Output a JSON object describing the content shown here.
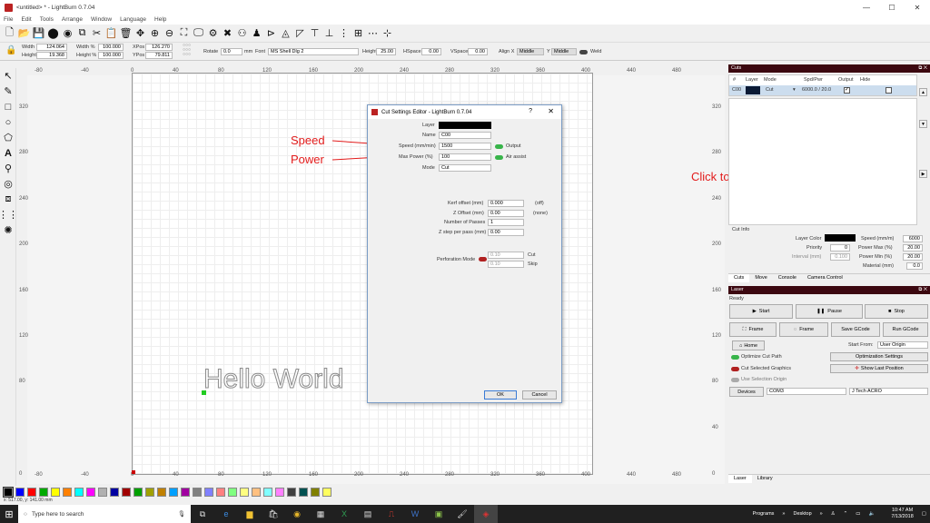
{
  "window": {
    "title": "<untitled> * - LightBurn 0.7.04"
  },
  "menu": [
    "File",
    "Edit",
    "Tools",
    "Arrange",
    "Window",
    "Language",
    "Help"
  ],
  "toolbar": {
    "icons": [
      "new-file-icon",
      "open-folder-icon",
      "save-icon",
      "import-icon",
      "export-icon",
      "copy-icon",
      "cut-icon",
      "paste-icon",
      "delete-icon",
      "move-icon",
      "zoom-in-icon",
      "zoom-out-icon",
      "zoom-frame-icon",
      "monitor-icon",
      "settings-icon",
      "tools-icon",
      "users-icon",
      "person-icon",
      "send-icon",
      "mirror-icon",
      "send-icon-2",
      "align-icon-1",
      "align-icon-2",
      "align-icon-3",
      "align-icon-4",
      "align-icon-5",
      "align-icon-6"
    ]
  },
  "transform": {
    "width_label": "Width",
    "width_value": "124.064",
    "height_label": "Height",
    "height_value": "19.368",
    "widthpct_label": "Width %",
    "widthpct_value": "100.000",
    "heightpct_label": "Height %",
    "heightpct_value": "100.000",
    "xpos_label": "XPos",
    "xpos_value": "126.270",
    "ypos_label": "YPos",
    "ypos_value": "79.811",
    "rotate_label": "Rotate",
    "rotate_value": "0.0",
    "mm_label": "mm"
  },
  "text_tools": {
    "font_label": "Font",
    "font_value": "MS Shell Dlg 2",
    "height_label": "Height",
    "height_value": "25.00",
    "hspace_label": "HSpace",
    "hspace_value": "0.00",
    "vspace_label": "VSpace",
    "vspace_value": "0.00",
    "alignx_label": "Align X",
    "alignx_value": "Middle",
    "aligny_label": "Y",
    "aligny_value": "Middle",
    "weld_label": "Weld"
  },
  "rulers": {
    "top": [
      "-80",
      "-40",
      "0",
      "40",
      "80",
      "120",
      "160",
      "200",
      "240",
      "280",
      "320",
      "360",
      "400",
      "440",
      "480"
    ],
    "left": [
      "320",
      "280",
      "240",
      "200",
      "160",
      "120",
      "80",
      "0"
    ],
    "bottom": [
      "-80",
      "-40",
      "0",
      "40",
      "80",
      "120",
      "160",
      "200",
      "240",
      "280",
      "320",
      "360",
      "400",
      "440",
      "480"
    ],
    "right": [
      "320",
      "280",
      "240",
      "200",
      "160",
      "120",
      "80",
      "40",
      "0"
    ]
  },
  "canvas_text": "Hello World",
  "annotations": {
    "speed": "Speed",
    "power": "Power",
    "click_note": "Click to change speed and power"
  },
  "dialog": {
    "title": "Cut Settings Editor - LightBurn 0.7.04",
    "help": "?",
    "close": "✕",
    "layer_label": "Layer",
    "name_label": "Name",
    "name_value": "C00",
    "speed_label": "Speed (mm/min)",
    "speed_value": "1500",
    "maxpower_label": "Max Power (%)",
    "maxpower_value": "100",
    "mode_label": "Mode",
    "mode_value": "Cut",
    "output_label": "Output",
    "airassist_label": "Air assist",
    "kerf_label": "Kerf offset (mm)",
    "kerf_value": "0.000",
    "kerf_state": "(off)",
    "zoffset_label": "Z Offset (mm)",
    "zoffset_value": "0.00",
    "zoffset_state": "(none)",
    "passes_label": "Number of Passes",
    "passes_value": "1",
    "zstep_label": "Z step per pass (mm)",
    "zstep_value": "0.00",
    "perforation_label": "Perforation Mode",
    "perf_cut_value": "0.10",
    "perf_cut_label": "Cut",
    "perf_skip_value": "0.10",
    "perf_skip_label": "Skip",
    "ok": "OK",
    "cancel": "Cancel"
  },
  "cuts_panel": {
    "title": "Cuts",
    "headers": [
      "#",
      "Layer",
      "Mode",
      "Spd/Pwr",
      "Output",
      "Hide"
    ],
    "row": {
      "num": "C00",
      "mode": "Cut",
      "spdpwr": "6000.0 / 20.0"
    },
    "cut_info_label": "Cut Info",
    "layer_color_label": "Layer Color",
    "speed_label": "Speed (mm/m)",
    "speed_value": "6000",
    "priority_label": "Priority",
    "priority_value": "0",
    "powermax_label": "Power Max (%)",
    "powermax_value": "20.00",
    "interval_label": "Interval (mm)",
    "interval_value": "0.100",
    "powermin_label": "Power Min (%)",
    "powermin_value": "20.00",
    "material_label": "Material (mm)",
    "material_value": "0.0",
    "tabs": [
      "Cuts",
      "Move",
      "Console",
      "Camera Control"
    ]
  },
  "laser_panel": {
    "title": "Laser",
    "status": "Ready",
    "start": "Start",
    "pause": "Pause",
    "stop": "Stop",
    "frame1": "Frame",
    "frame2": "Frame",
    "save_gcode": "Save GCode",
    "run_gcode": "Run GCode",
    "home": "Home",
    "start_from_label": "Start From:",
    "start_from_value": "User Origin",
    "optimize_cut_path": "Optimize Cut Path",
    "optimization_settings": "Optimization Settings",
    "cut_selected": "Cut Selected Graphics",
    "show_last_position": "Show Last Position",
    "use_selection_origin": "Use Selection Origin",
    "devices": "Devices",
    "port": "COM3",
    "device": "J Tech ACRO",
    "tabs": [
      "Laser",
      "Library"
    ]
  },
  "palette_colors": [
    "#000000",
    "#0000ff",
    "#ff0000",
    "#00aa00",
    "#ffff00",
    "#ff8000",
    "#00ffff",
    "#ff00ff",
    "#b0b0b0",
    "#0000a0",
    "#a00000",
    "#00a000",
    "#a0a000",
    "#c08000",
    "#00a0ff",
    "#a000a0",
    "#808080",
    "#8080ff",
    "#ff8080",
    "#80ff80",
    "#ffff80",
    "#ffc080",
    "#80ffff",
    "#ff80ff",
    "#404040",
    "#005050",
    "#808000",
    "#ffff60"
  ],
  "status_text": "x: 517.00, y: 141.00 mm",
  "taskbar": {
    "search_placeholder": "Type here to search",
    "programs": "Programs",
    "desktop": "Desktop",
    "time": "10:47 AM",
    "date": "7/13/2018"
  }
}
